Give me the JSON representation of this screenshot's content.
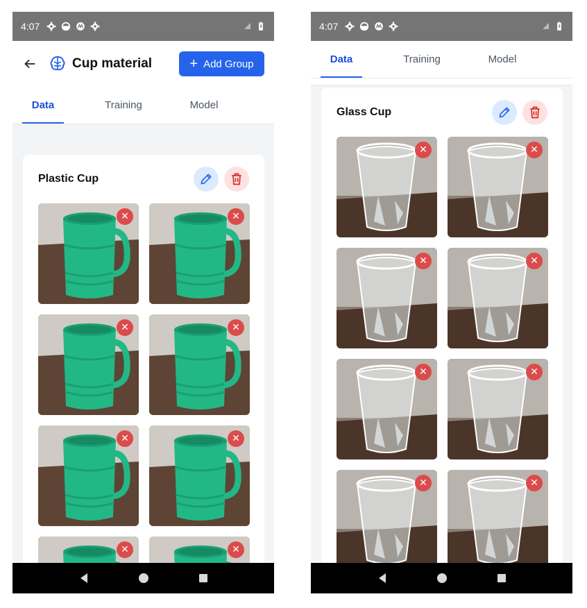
{
  "status": {
    "time": "4:07"
  },
  "left": {
    "title": "Cup material",
    "add_group_label": "Add Group",
    "tabs": [
      {
        "label": "Data"
      },
      {
        "label": "Training"
      },
      {
        "label": "Model"
      }
    ],
    "active_tab": "Data",
    "group": {
      "name": "Plastic Cup",
      "image_count_visible": 8
    }
  },
  "right": {
    "tabs": [
      {
        "label": "Data"
      },
      {
        "label": "Training"
      },
      {
        "label": "Model"
      }
    ],
    "active_tab": "Data",
    "group": {
      "name": "Glass Cup",
      "image_count_visible": 8
    }
  },
  "colors": {
    "accent": "#2563eb",
    "plastic_cup": "#1fbf8c",
    "remove_badge": "#dc4b4b"
  },
  "remove_glyph": "✕"
}
